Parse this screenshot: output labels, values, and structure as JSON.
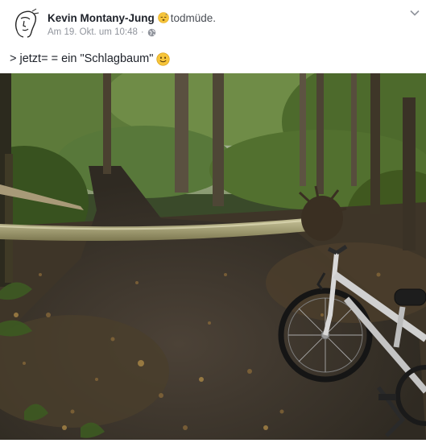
{
  "post": {
    "author_name": "Kevin Montany-Jung",
    "feeling_icon": "sleepy-emoji-icon",
    "feeling_text": "todmüde.",
    "timestamp": "Am 19. Okt. um 10:48",
    "separator": "·",
    "privacy_icon": "globe-icon",
    "text": "> jetzt= = ein \"Schlagbaum\"",
    "text_emoji_icon": "smile-emoji-icon",
    "menu_icon": "chevron-down-icon"
  },
  "photo": {
    "subject": "fallen-tree-across-forest-path-with-bicycle"
  }
}
